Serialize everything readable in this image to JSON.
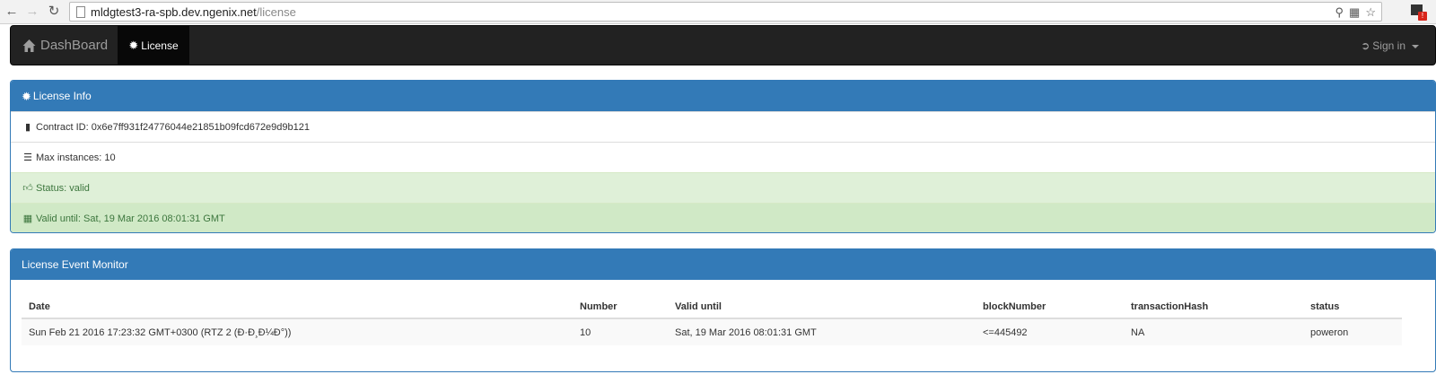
{
  "browser": {
    "url_host": "mldgtest3-ra-spb.dev.ngenix.net",
    "url_path": "/license",
    "back_icon": "arrow-left-icon",
    "forward_icon": "arrow-right-icon",
    "reload_icon": "reload-icon"
  },
  "navbar": {
    "brand_label": "DashBoard",
    "active_tab_label": "License",
    "signin_label": "Sign in"
  },
  "license_info": {
    "title": "License Info",
    "contract_label": "Contract ID: 0x6e7ff931f24776044e21851b09fcd672e9d9b121",
    "max_instances_label": "Max instances: 10",
    "status_label": "Status: valid",
    "valid_until_label": "Valid until: Sat, 19 Mar 2016 08:01:31 GMT"
  },
  "event_monitor": {
    "title": "License Event Monitor",
    "columns": [
      "Date",
      "Number",
      "Valid until",
      "blockNumber",
      "transactionHash",
      "status"
    ],
    "rows": [
      [
        "Sun Feb 21 2016 17:23:32 GMT+0300 (RTZ 2 (Ð·Ð¸Ð¼Ð°))",
        "10",
        "Sat, 19 Mar 2016 08:01:31 GMT",
        "<=445492",
        "NA",
        "poweron"
      ]
    ]
  },
  "colors": {
    "primary": "#337ab7",
    "navbar_bg": "#222222",
    "success_bg": "#dff0d8",
    "success_text": "#3c763d"
  }
}
